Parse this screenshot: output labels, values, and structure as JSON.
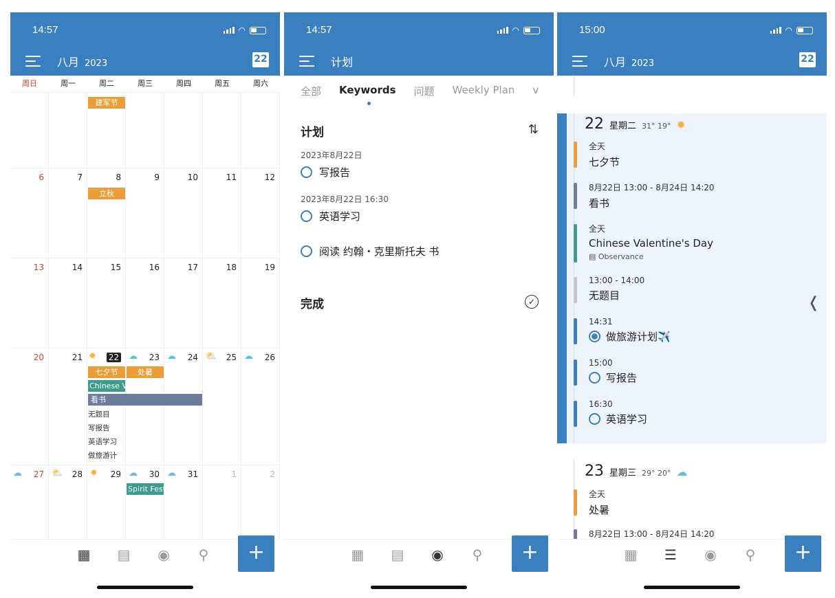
{
  "panel1": {
    "status_time": "14:57",
    "month": "八月",
    "year": "2023",
    "today_badge": "22",
    "weekdays": [
      "周日",
      "周一",
      "周二",
      "周三",
      "周四",
      "周五",
      "周六"
    ],
    "rows": [
      {
        "days": [
          "",
          "",
          "",
          "",
          "",
          "",
          ""
        ]
      },
      {
        "days": [
          "6",
          "7",
          "8",
          "9",
          "10",
          "11",
          "12"
        ]
      },
      {
        "days": [
          "13",
          "14",
          "15",
          "16",
          "17",
          "18",
          "19"
        ]
      },
      {
        "days": [
          "20",
          "21",
          "22",
          "23",
          "24",
          "25",
          "26"
        ]
      },
      {
        "days": [
          "27",
          "28",
          "29",
          "30",
          "31",
          "1",
          "2"
        ]
      }
    ],
    "events": {
      "jianjun": "建军节",
      "liqiu": "立秋",
      "qixi": "七夕节",
      "chushu": "处暑",
      "chinesev": "Chinese V",
      "kanshu": "看书",
      "wuti": "无题目",
      "baogao": "写报告",
      "yingyu": "英语学习",
      "lvyou": "做旅游计",
      "spirit": "Spirit Fest"
    },
    "weather_icons": [
      "sun-icon",
      "rain-cloud-icon",
      "rain-cloud-icon",
      "sun-cloud-icon",
      "rain-cloud-icon"
    ],
    "weather_icons_row5": [
      "rain-cloud-icon",
      "sun-cloud-icon",
      "sun-icon",
      "rain-cloud-icon",
      "rain-cloud-icon"
    ]
  },
  "panel2": {
    "status_time": "14:57",
    "title": "计划",
    "tabs": [
      "全部",
      "Keywords",
      "问题",
      "Weekly Plan",
      "v"
    ],
    "section1": "计划",
    "section2": "完成",
    "tasks": [
      {
        "date": "2023年8月22日",
        "label": "写报告"
      },
      {
        "date": "2023年8月22日 16:30",
        "label": "英语学习"
      },
      {
        "date": "",
        "label": "阅读 约翰・克里斯托夫 书"
      }
    ]
  },
  "panel3": {
    "status_time": "15:00",
    "month": "八月",
    "year": "2023",
    "today_badge": "22",
    "day1": {
      "num": "22",
      "weekday": "星期二",
      "temp": "31° 19°",
      "items": [
        {
          "t1": "全天",
          "t2": "七夕节",
          "color": "#ec9d35"
        },
        {
          "t1": "8月22日 13:00 - 8月24日 14:20",
          "t2": "看书",
          "color": "#6c7c9c"
        },
        {
          "t1": "全天",
          "t2": "Chinese Valentine's Day",
          "t3": "Observance",
          "color": "#3e9c8f"
        },
        {
          "t1": "13:00 - 14:00",
          "t2": "无题目",
          "color": "#c9c3cf"
        },
        {
          "t1": "14:31",
          "t2": "做旅游计划✈️",
          "color": "#3a7fc0"
        },
        {
          "t1": "15:00",
          "t2": "写报告",
          "color": "#3a7fc0"
        },
        {
          "t1": "16:30",
          "t2": "英语学习",
          "color": "#3a7fc0"
        }
      ]
    },
    "day2": {
      "num": "23",
      "weekday": "星期三",
      "temp": "29° 20°",
      "items": [
        {
          "t1": "全天",
          "t2": "处暑",
          "color": "#ec9d35"
        },
        {
          "t1": "8月22日 13:00 - 8月24日 14:20",
          "t2": "",
          "color": "#6c7c9c"
        }
      ]
    }
  },
  "colors": {
    "primary": "#3a7fc0",
    "orange": "#ec9d35",
    "teal": "#3e9c8f",
    "slate": "#6c7c9c",
    "red": "#d2452b"
  }
}
